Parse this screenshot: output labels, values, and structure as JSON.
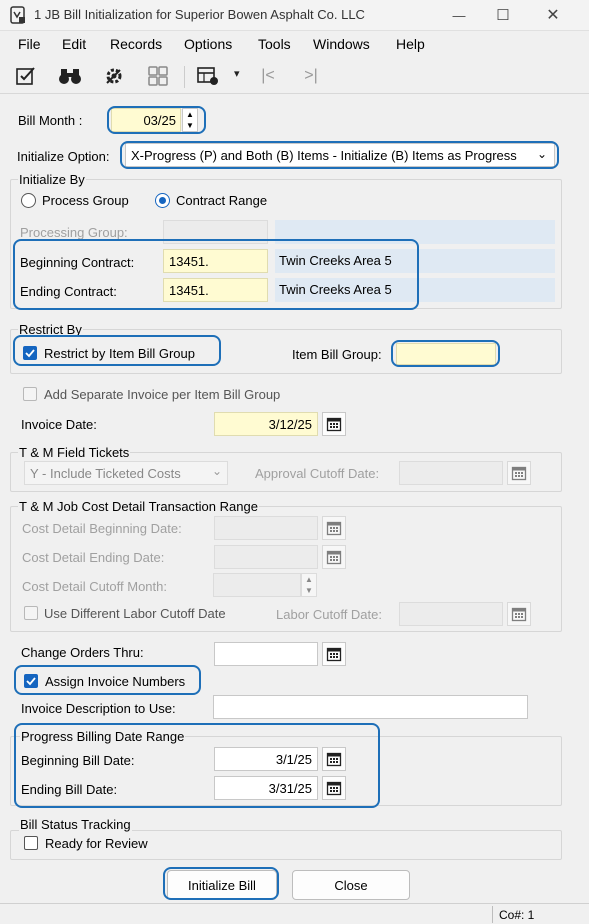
{
  "window": {
    "title": "1 JB Bill Initialization for Superior Bowen  Asphalt Co. LLC",
    "minimize_glyph": "—",
    "maximize_glyph": "☐",
    "close_glyph": "✕"
  },
  "menu": [
    "File",
    "Edit",
    "Records",
    "Options",
    "Tools",
    "Windows",
    "Help"
  ],
  "toolbar": {
    "icons": [
      "edit-icon",
      "binoculars-icon",
      "settings-icon",
      "calculator-icon",
      "grid-icon",
      "first-record-icon",
      "last-record-icon"
    ],
    "first_glyph": "|<",
    "last_glyph": ">|",
    "dropdown_glyph": "▾"
  },
  "bill_month": {
    "label": "Bill Month :",
    "value": "03/25"
  },
  "initialize_option": {
    "label": "Initialize Option:",
    "value": "X-Progress (P) and Both (B) Items - Initialize (B) Items as Progress"
  },
  "initialize_by": {
    "title": "Initialize By",
    "radio_process_group": "Process Group",
    "radio_contract_range": "Contract Range",
    "selected": "Contract Range",
    "processing_group_label": "Processing Group:",
    "beginning_contract_label": "Beginning Contract:",
    "beginning_contract_value": "13451.",
    "beginning_contract_desc": "Twin Creeks  Area 5",
    "ending_contract_label": "Ending Contract:",
    "ending_contract_value": "13451.",
    "ending_contract_desc": "Twin Creeks  Area 5"
  },
  "restrict_by": {
    "title": "Restrict By",
    "restrict_item_bill_group_label": "Restrict by Item Bill Group",
    "restrict_item_bill_group_checked": true,
    "item_bill_group_label": "Item Bill Group:",
    "item_bill_group_value": ""
  },
  "add_separate_invoice": {
    "label": "Add Separate Invoice per Item Bill Group",
    "checked": false
  },
  "invoice_date": {
    "label": "Invoice Date:",
    "value": "3/12/25"
  },
  "tm_field_tickets": {
    "title": "T & M Field Tickets",
    "option_value": "Y - Include Ticketed Costs",
    "approval_cutoff_label": "Approval Cutoff Date:",
    "approval_cutoff_value": ""
  },
  "tm_job_cost": {
    "title": "T & M Job Cost Detail Transaction Range",
    "beginning_label": "Cost Detail Beginning Date:",
    "ending_label": "Cost Detail Ending Date:",
    "cutoff_month_label": "Cost Detail Cutoff Month:",
    "use_diff_labor_label": "Use Different Labor Cutoff Date",
    "labor_cutoff_label": "Labor Cutoff Date:"
  },
  "change_orders": {
    "label": "Change Orders Thru:",
    "value": ""
  },
  "assign_invoice_numbers": {
    "label": "Assign Invoice Numbers",
    "checked": true
  },
  "invoice_description": {
    "label": "Invoice Description to Use:",
    "value": ""
  },
  "progress_billing": {
    "title": "Progress Billing Date Range",
    "beginning_label": "Beginning Bill Date:",
    "beginning_value": "3/1/25",
    "ending_label": "Ending Bill Date:",
    "ending_value": "3/31/25"
  },
  "bill_status": {
    "title": "Bill Status Tracking",
    "ready_for_review_label": "Ready for Review",
    "checked": false
  },
  "buttons": {
    "initialize": "Initialize Bill",
    "close": "Close"
  },
  "status": {
    "company": "Co#: 1"
  },
  "colors": {
    "highlight": "#1e6fb8",
    "accent": "#1565c0",
    "required_field": "#fffbd2",
    "readonly_field": "#dfe9f3"
  }
}
